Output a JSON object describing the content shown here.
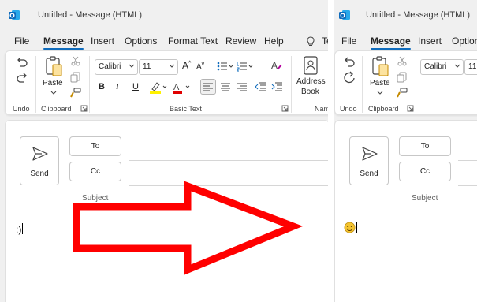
{
  "colors": {
    "accent": "#0f6cbd",
    "arrow": "#ff0000",
    "highlight": "#fff100",
    "fontColor": "#e00000",
    "emoji": "#f4c430"
  },
  "left_window": {
    "title": "Untitled  -  Message (HTML)",
    "menu": [
      "File",
      "Message",
      "Insert",
      "Options",
      "Format Text",
      "Review",
      "Help",
      "Te"
    ],
    "ribbon": {
      "undo_group": "Undo",
      "paste_label": "Paste",
      "clipboard_group": "Clipboard",
      "font_name": "Calibri",
      "font_size": "11",
      "bold": "B",
      "italic": "I",
      "underline": "U",
      "basic_text_group": "Basic Text",
      "address_book_line1": "Address",
      "address_book_line2": "Book",
      "names_group": "Nam"
    },
    "compose": {
      "send_label": "Send",
      "to_label": "To",
      "cc_label": "Cc",
      "subject_label": "Subject",
      "body": ":)"
    }
  },
  "right_window": {
    "title": "Untitled  -  Message (HTML)",
    "menu": [
      "File",
      "Message",
      "Insert",
      "Option"
    ],
    "ribbon": {
      "paste_label": "Paste",
      "undo_group": "Undo",
      "clipboard_group": "Clipboard",
      "font_name": "Calibri",
      "font_size": "11"
    },
    "compose": {
      "send_label": "Send",
      "to_label": "To",
      "cc_label": "Cc",
      "subject_label": "Subject",
      "body": "😊"
    }
  },
  "icons": [
    "outlook-icon",
    "undo-icon",
    "redo-icon",
    "paste-icon",
    "cut-icon",
    "copy-icon",
    "format-painter-icon",
    "grow-font-icon",
    "shrink-font-icon",
    "bullets-icon",
    "numbering-icon",
    "clear-format-icon",
    "highlight-icon",
    "font-color-icon",
    "align-left-icon",
    "align-center-icon",
    "align-right-icon",
    "decrease-indent-icon",
    "increase-indent-icon",
    "address-book-icon",
    "send-icon",
    "launcher-icon",
    "smiley-emoji-icon",
    "red-arrow-icon"
  ]
}
